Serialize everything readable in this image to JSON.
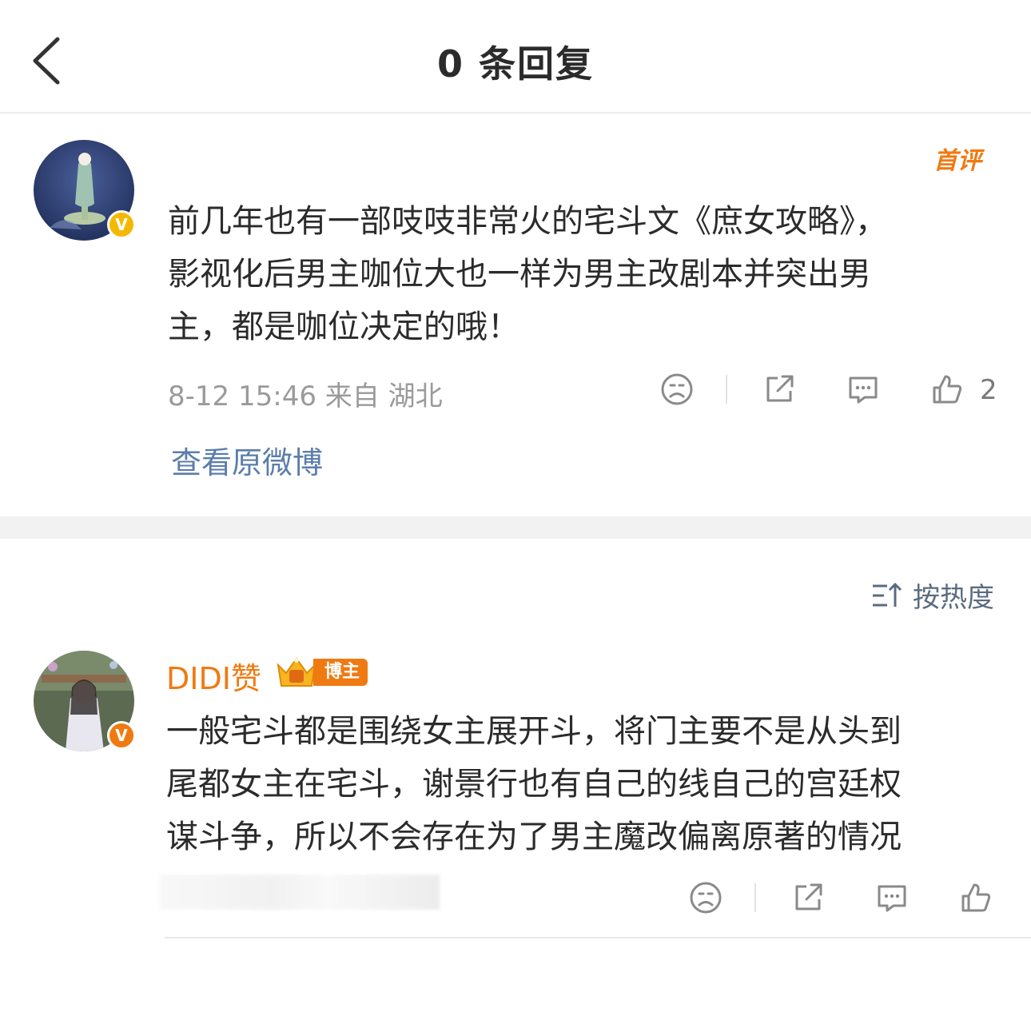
{
  "header": {
    "title": "0 条回复"
  },
  "root_comment": {
    "badge": "首评",
    "text_lines": [
      "前几年也有一部吱吱非常火的宅斗文《庶女攻略》，",
      "影视化后男主咖位大也一样为男主改剧本并突出男",
      "主，都是咖位决定的哦！"
    ],
    "meta": "8-12 15:46 来自 湖北",
    "like_count": "2",
    "view_original": "查看原微博",
    "verified_badge": "V"
  },
  "sort": {
    "label": "按热度"
  },
  "reply": {
    "username": "DIDI赞",
    "badge_label": "博主",
    "verified_badge": "V",
    "text_lines": [
      "一般宅斗都是围绕女主展开斗，将门主要不是从头到",
      "尾都女主在宅斗，谢景行也有自己的线自己的宫廷权",
      "谋斗争，所以不会存在为了男主魔改偏离原著的情况"
    ]
  },
  "icons": {
    "back": "chevron-left-icon",
    "dislike": "sad-face-icon",
    "share": "share-icon",
    "comment": "comment-bubble-icon",
    "like": "thumbs-up-icon",
    "sort": "sort-icon",
    "crown": "crown-icon"
  },
  "colors": {
    "accent_orange": "#f07a12",
    "link_blue": "#5b7dab",
    "verified_yellow": "#f5b800",
    "meta_gray": "#9a9a9a"
  }
}
